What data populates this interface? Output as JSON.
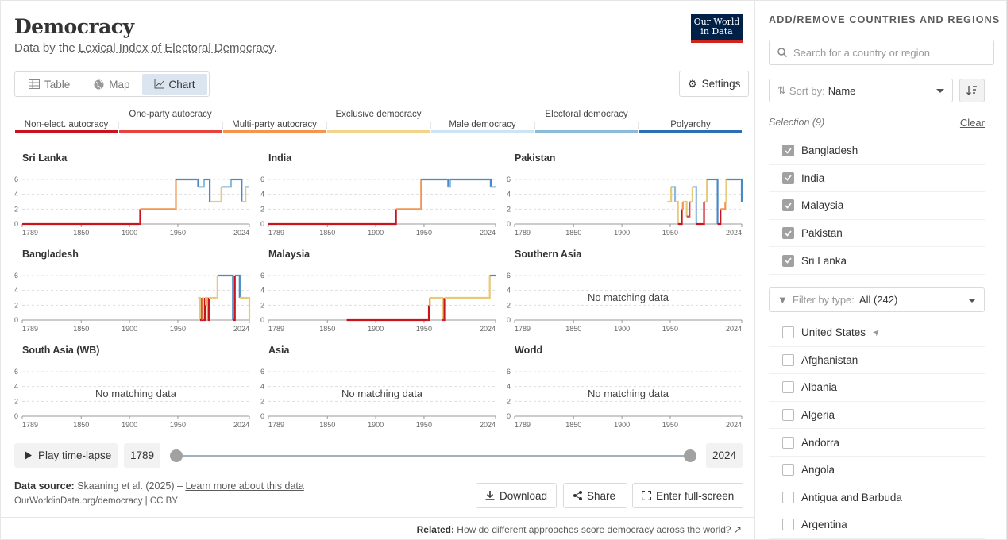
{
  "header": {
    "title": "Democracy",
    "subtitle_prefix": "Data by the ",
    "subtitle_link": "Lexical Index of Electoral Democracy",
    "subtitle_suffix": ".",
    "logo_line1": "Our World",
    "logo_line2": "in Data"
  },
  "tabs": [
    {
      "label": "Table",
      "icon": "table-icon"
    },
    {
      "label": "Map",
      "icon": "globe-icon"
    },
    {
      "label": "Chart",
      "icon": "line-chart-icon",
      "active": true
    }
  ],
  "settings_label": "Settings",
  "legend": [
    {
      "label": "Non-elect. autocracy",
      "color": "#c9141f"
    },
    {
      "label": "One-party autocracy",
      "color": "#e6443a"
    },
    {
      "label": "Multi-party autocracy",
      "color": "#f4944f"
    },
    {
      "label": "Exclusive democracy",
      "color": "#f2d48b"
    },
    {
      "label": "Male democracy",
      "color": "#cfe4f3"
    },
    {
      "label": "Electoral democracy",
      "color": "#8bbadb"
    },
    {
      "label": "Polyarchy",
      "color": "#2c6fb2"
    }
  ],
  "chart_data": {
    "type": "line",
    "ylim": [
      0,
      6
    ],
    "yticks": [
      0,
      2,
      4,
      6
    ],
    "xticks": [
      "1789",
      "1850",
      "1900",
      "1950",
      "2024"
    ],
    "xlim": [
      1789,
      2024
    ],
    "no_data_label": "No matching data",
    "panels": [
      {
        "name": "Sri Lanka",
        "points": [
          [
            1789,
            0
          ],
          [
            1910,
            0
          ],
          [
            1911,
            2
          ],
          [
            1947,
            2
          ],
          [
            1948,
            6
          ],
          [
            1970,
            6
          ],
          [
            1971,
            5
          ],
          [
            1976,
            5
          ],
          [
            1977,
            6
          ],
          [
            1982,
            6
          ],
          [
            1983,
            3
          ],
          [
            1994,
            3
          ],
          [
            1995,
            5
          ],
          [
            2004,
            5
          ],
          [
            2005,
            6
          ],
          [
            2015,
            6
          ],
          [
            2016,
            3
          ],
          [
            2019,
            3
          ],
          [
            2020,
            5
          ],
          [
            2024,
            5
          ]
        ]
      },
      {
        "name": "India",
        "points": [
          [
            1789,
            0
          ],
          [
            1920,
            0
          ],
          [
            1921,
            2
          ],
          [
            1946,
            2
          ],
          [
            1947,
            6
          ],
          [
            1974,
            6
          ],
          [
            1975,
            5
          ],
          [
            1976,
            5
          ],
          [
            1977,
            6
          ],
          [
            2018,
            6
          ],
          [
            2019,
            5
          ],
          [
            2024,
            5
          ]
        ]
      },
      {
        "name": "Pakistan",
        "points": [
          [
            1947,
            3
          ],
          [
            1950,
            3
          ],
          [
            1951,
            5
          ],
          [
            1954,
            5
          ],
          [
            1955,
            3
          ],
          [
            1957,
            3
          ],
          [
            1958,
            0
          ],
          [
            1961,
            0
          ],
          [
            1962,
            2
          ],
          [
            1963,
            3
          ],
          [
            1966,
            3
          ],
          [
            1967,
            1
          ],
          [
            1969,
            1
          ],
          [
            1970,
            3
          ],
          [
            1972,
            3
          ],
          [
            1973,
            5
          ],
          [
            1976,
            5
          ],
          [
            1977,
            0
          ],
          [
            1984,
            0
          ],
          [
            1985,
            3
          ],
          [
            1987,
            3
          ],
          [
            1988,
            6
          ],
          [
            1998,
            6
          ],
          [
            1999,
            0
          ],
          [
            2001,
            0
          ],
          [
            2002,
            2
          ],
          [
            2007,
            3
          ],
          [
            2008,
            6
          ],
          [
            2023,
            6
          ],
          [
            2024,
            3
          ]
        ]
      },
      {
        "name": "Bangladesh",
        "points": [
          [
            1971,
            3
          ],
          [
            1972,
            3
          ],
          [
            1973,
            0
          ],
          [
            1974,
            0
          ],
          [
            1975,
            3
          ],
          [
            1976,
            0
          ],
          [
            1977,
            0
          ],
          [
            1978,
            3
          ],
          [
            1979,
            2
          ],
          [
            1980,
            3
          ],
          [
            1981,
            0
          ],
          [
            1982,
            3
          ],
          [
            1985,
            3
          ],
          [
            1986,
            3
          ],
          [
            1990,
            3
          ],
          [
            1991,
            6
          ],
          [
            2006,
            6
          ],
          [
            2007,
            0
          ],
          [
            2008,
            0
          ],
          [
            2009,
            6
          ],
          [
            2013,
            6
          ],
          [
            2014,
            3
          ],
          [
            2022,
            3
          ],
          [
            2023,
            3
          ],
          [
            2024,
            0
          ]
        ]
      },
      {
        "name": "Malaysia",
        "points": [
          [
            1870,
            0
          ],
          [
            1954,
            0
          ],
          [
            1955,
            2
          ],
          [
            1956,
            3
          ],
          [
            1957,
            3
          ],
          [
            1968,
            3
          ],
          [
            1969,
            0
          ],
          [
            1970,
            0
          ],
          [
            1971,
            3
          ],
          [
            2017,
            3
          ],
          [
            2018,
            6
          ],
          [
            2024,
            6
          ]
        ]
      },
      {
        "name": "Southern Asia",
        "points": []
      },
      {
        "name": "South Asia (WB)",
        "points": []
      },
      {
        "name": "Asia",
        "points": []
      },
      {
        "name": "World",
        "points": []
      }
    ]
  },
  "timeline": {
    "play_label": "Play time-lapse",
    "start_year": "1789",
    "end_year": "2024"
  },
  "footer": {
    "source_label": "Data source:",
    "source_text": "Skaaning et al. (2025) –",
    "learn_more": "Learn more about this data",
    "license": "OurWorldinData.org/democracy | CC BY",
    "download_label": "Download",
    "share_label": "Share",
    "fullscreen_label": "Enter full-screen",
    "related_label": "Related:",
    "related_link": "How do different approaches score democracy across the world?"
  },
  "sidebar": {
    "title": "ADD/REMOVE COUNTRIES AND REGIONS",
    "search_placeholder": "Search for a country or region",
    "sort_label": "Sort by:",
    "sort_value": "Name",
    "selection_label": "Selection (9)",
    "clear_label": "Clear",
    "selected": [
      "Bangladesh",
      "India",
      "Malaysia",
      "Pakistan",
      "Sri Lanka"
    ],
    "filter_label": "Filter by type:",
    "filter_value": "All (242)",
    "countries": [
      "United States",
      "Afghanistan",
      "Albania",
      "Algeria",
      "Andorra",
      "Angola",
      "Antigua and Barbuda",
      "Argentina"
    ]
  }
}
